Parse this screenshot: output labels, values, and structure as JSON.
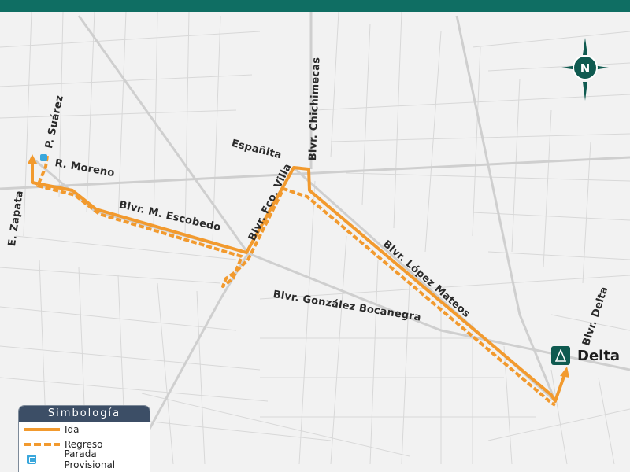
{
  "header": {
    "color": "#0f6e63"
  },
  "colors": {
    "route": "#f29a2e",
    "street_minor": "#d6d6d6",
    "street_major": "#c9c9c9",
    "stop": "#3aa7dc",
    "destination": "#0f5a50"
  },
  "streets": [
    {
      "id": "p-suarez",
      "label": "P. Suárez"
    },
    {
      "id": "r-moreno",
      "label": "R. Moreno"
    },
    {
      "id": "e-zapata",
      "label": "E. Zapata"
    },
    {
      "id": "blvr-m-escobedo",
      "label": "Blvr. M. Escobedo"
    },
    {
      "id": "espanita",
      "label": "Españita"
    },
    {
      "id": "blvr-chichimecas",
      "label": "Blvr. Chichimecas"
    },
    {
      "id": "blvr-fco-villa",
      "label": "Blvr. Fco. Villa"
    },
    {
      "id": "blvr-gonzalez-bocanegra",
      "label": "Blvr. González Bocanegra"
    },
    {
      "id": "blvr-lopez-mateos",
      "label": "Blvr. López Mateos"
    },
    {
      "id": "blvr-delta",
      "label": "Blvr. Delta"
    }
  ],
  "destination": {
    "label": "Delta",
    "icon": "delta-symbol-icon"
  },
  "compass": {
    "label": "N",
    "icon": "north-compass-icon"
  },
  "legend": {
    "title": "Simbología",
    "items": [
      {
        "label": "Ida",
        "icon": "solid-line"
      },
      {
        "label": "Regreso",
        "icon": "dashed-line"
      },
      {
        "label": "Parada Provisional",
        "icon": "bus-stop-icon"
      }
    ]
  }
}
